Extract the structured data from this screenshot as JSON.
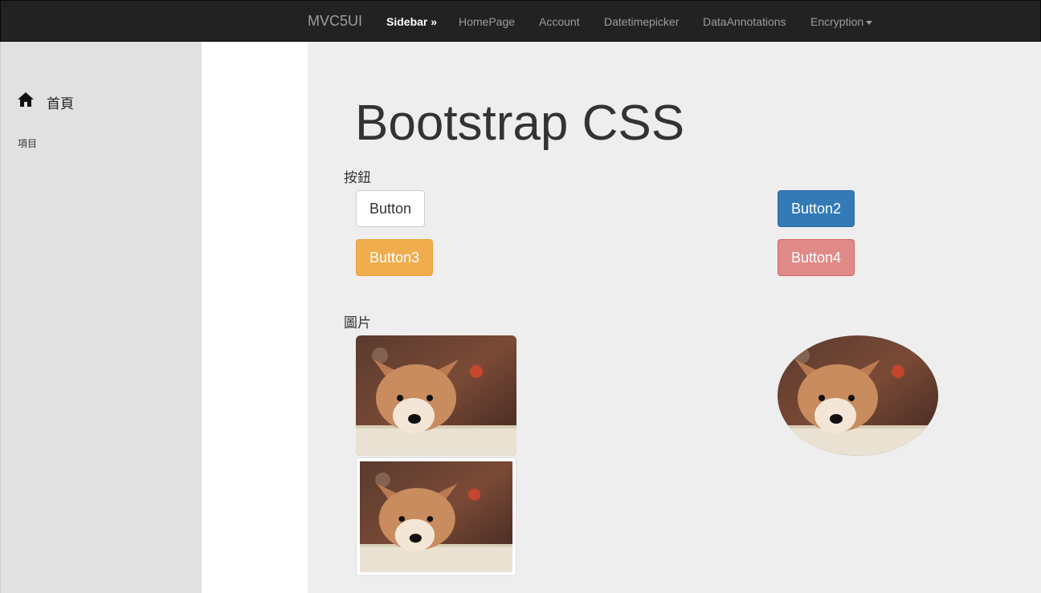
{
  "navbar": {
    "brand": "MVC5UI",
    "items": [
      {
        "label": "Sidebar »",
        "active": true
      },
      {
        "label": "HomePage"
      },
      {
        "label": "Account"
      },
      {
        "label": "Datetimepicker"
      },
      {
        "label": "DataAnnotations"
      },
      {
        "label": "Encryption",
        "dropdown": true
      }
    ]
  },
  "sidebar": {
    "home_icon": "home-icon",
    "home_label": "首頁",
    "sub_label": "項目"
  },
  "main": {
    "title": "Bootstrap CSS",
    "buttons_section": "按鈕",
    "buttons": [
      "Button",
      "Button2",
      "Button3",
      "Button4"
    ],
    "images_section": "圖片",
    "image_subject": "puppy photo"
  },
  "colors": {
    "navbar_bg": "#222222",
    "sidebar_bg": "#e1e1e1",
    "main_bg": "#eeeeee",
    "primary": "#337ab7",
    "warning": "#f0ad4e",
    "danger": "#e08a88"
  }
}
